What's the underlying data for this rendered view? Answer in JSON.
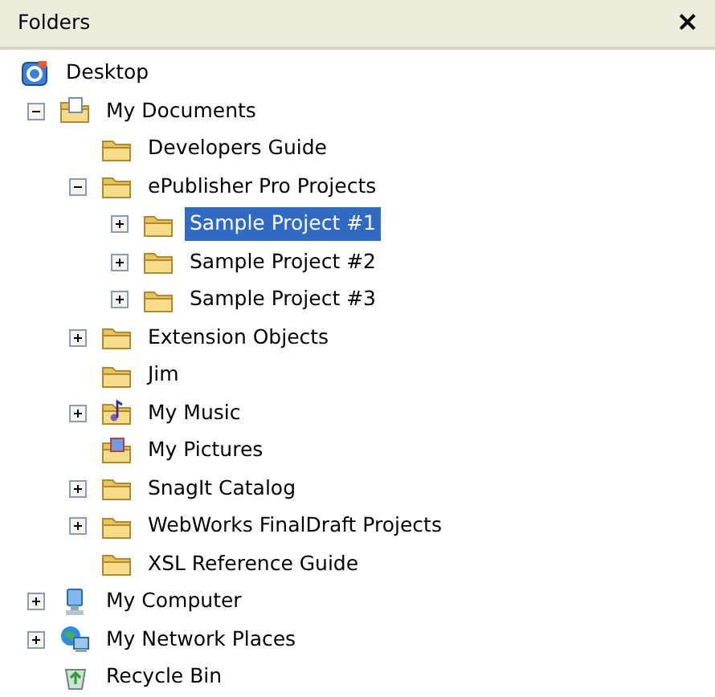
{
  "panel": {
    "title": "Folders",
    "close": "×"
  },
  "tree": [
    {
      "label": "Desktop",
      "kind": "desktop",
      "selected": false,
      "children": [
        {
          "label": "My Documents",
          "kind": "documents",
          "expanded": true,
          "selected": false,
          "children": [
            {
              "label": "Developers Guide",
              "kind": "folder",
              "selected": false
            },
            {
              "label": "ePublisher Pro Projects",
              "kind": "folder",
              "expanded": true,
              "selected": false,
              "children": [
                {
                  "label": "Sample Project #1",
                  "kind": "folder",
                  "expanded": false,
                  "selected": true
                },
                {
                  "label": "Sample Project #2",
                  "kind": "folder",
                  "expanded": false,
                  "selected": false
                },
                {
                  "label": "Sample Project #3",
                  "kind": "folder",
                  "expanded": false,
                  "selected": false
                }
              ]
            },
            {
              "label": "Extension Objects",
              "kind": "folder",
              "expanded": false,
              "selected": false
            },
            {
              "label": "Jim",
              "kind": "folder",
              "selected": false
            },
            {
              "label": "My Music",
              "kind": "music",
              "expanded": false,
              "selected": false
            },
            {
              "label": "My Pictures",
              "kind": "pictures",
              "selected": false
            },
            {
              "label": "SnagIt Catalog",
              "kind": "folder",
              "expanded": false,
              "selected": false
            },
            {
              "label": "WebWorks FinalDraft Projects",
              "kind": "folder",
              "expanded": false,
              "selected": false
            },
            {
              "label": "XSL Reference Guide",
              "kind": "folder",
              "selected": false
            }
          ]
        },
        {
          "label": "My Computer",
          "kind": "computer",
          "expanded": false,
          "selected": false
        },
        {
          "label": "My Network Places",
          "kind": "network",
          "expanded": false,
          "selected": false
        },
        {
          "label": "Recycle Bin",
          "kind": "recycle",
          "selected": false
        }
      ]
    }
  ]
}
